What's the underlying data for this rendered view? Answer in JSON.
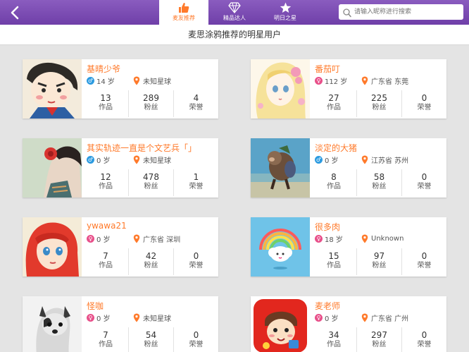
{
  "header": {
    "tabs": [
      {
        "label": "麦友推荐",
        "icon": "thumbs-up-icon",
        "active": true
      },
      {
        "label": "精品达人",
        "icon": "diamond-icon",
        "active": false
      },
      {
        "label": "明日之星",
        "icon": "star-icon",
        "active": false
      }
    ],
    "search_placeholder": "请输入昵称进行搜索"
  },
  "subtitle": "麦思涂鸦推荐的明星用户",
  "stat_labels": {
    "works": "作品",
    "fans": "粉丝",
    "honors": "荣誉"
  },
  "colors": {
    "accent": "#ff7a2b",
    "header": "#7b4bb3",
    "male": "#2d9be0",
    "female": "#e8508a"
  },
  "users": [
    {
      "name": "基晴少爷",
      "gender": "male",
      "gender_symbol": "♂",
      "age": "14 岁",
      "location": "未知星球",
      "works": "13",
      "fans": "289",
      "honors": "4"
    },
    {
      "name": "番茄叮",
      "gender": "female",
      "gender_symbol": "♀",
      "age": "112 岁",
      "location": "广东省 东莞",
      "works": "27",
      "fans": "225",
      "honors": "0"
    },
    {
      "name": "其实轨迹一直是个文艺兵「」",
      "gender": "male",
      "gender_symbol": "♂",
      "age": "0 岁",
      "location": "未知星球",
      "works": "12",
      "fans": "478",
      "honors": "1"
    },
    {
      "name": "淡定的大猪",
      "gender": "male",
      "gender_symbol": "♂",
      "age": "0 岁",
      "location": "江苏省 苏州",
      "works": "8",
      "fans": "58",
      "honors": "0"
    },
    {
      "name": "ywawa21",
      "gender": "female",
      "gender_symbol": "♀",
      "age": "0 岁",
      "location": "广东省 深圳",
      "works": "7",
      "fans": "42",
      "honors": "0"
    },
    {
      "name": "很多肉",
      "gender": "female",
      "gender_symbol": "♀",
      "age": "18 岁",
      "location": "Unknown",
      "works": "15",
      "fans": "97",
      "honors": "0"
    },
    {
      "name": "怪咖",
      "gender": "female",
      "gender_symbol": "♀",
      "age": "0 岁",
      "location": "未知星球",
      "works": "7",
      "fans": "54",
      "honors": "0"
    },
    {
      "name": "麦老师",
      "gender": "female",
      "gender_symbol": "♀",
      "age": "0 岁",
      "location": "广东省 广州",
      "works": "34",
      "fans": "297",
      "honors": "0"
    }
  ]
}
